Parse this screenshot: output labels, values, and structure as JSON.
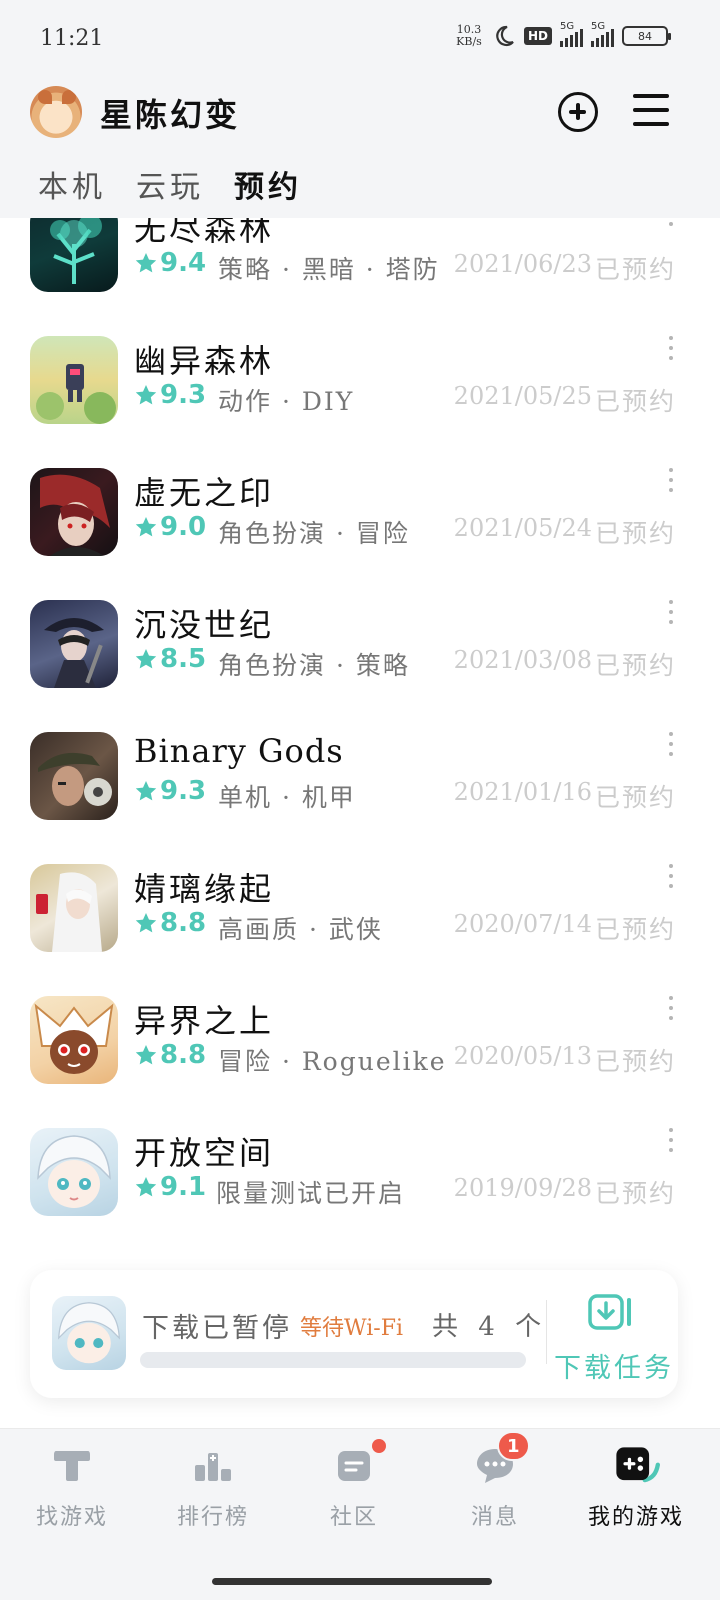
{
  "status_bar": {
    "time": "11:21",
    "net_speed_value": "10.3",
    "net_speed_unit": "KB/s",
    "hd_label": "HD",
    "signal1_label": "5G",
    "signal2_label": "5G",
    "battery": "84"
  },
  "header": {
    "title": "星陈幻变",
    "tabs": [
      {
        "label": "本机",
        "active": false
      },
      {
        "label": "云玩",
        "active": false
      },
      {
        "label": "预约",
        "active": true
      }
    ]
  },
  "games": [
    {
      "name": "无尽森林",
      "rating": "9.4",
      "tags": "策略 · 黑暗 · 塔防",
      "date": "2021/06/23",
      "status": "已预约"
    },
    {
      "name": "幽异森林",
      "rating": "9.3",
      "tags": "动作 · DIY",
      "date": "2021/05/25",
      "status": "已预约"
    },
    {
      "name": "虚无之印",
      "rating": "9.0",
      "tags": "角色扮演 · 冒险",
      "date": "2021/05/24",
      "status": "已预约"
    },
    {
      "name": "沉没世纪",
      "rating": "8.5",
      "tags": "角色扮演 · 策略",
      "date": "2021/03/08",
      "status": "已预约"
    },
    {
      "name": "Binary Gods",
      "rating": "9.3",
      "tags": "单机 · 机甲",
      "date": "2021/01/16",
      "status": "已预约"
    },
    {
      "name": "婧璃缘起",
      "rating": "8.8",
      "tags": "高画质 · 武侠",
      "date": "2020/07/14",
      "status": "已预约"
    },
    {
      "name": "异界之上",
      "rating": "8.8",
      "tags": "冒险 · Roguelike",
      "date": "2020/05/13",
      "status": "已预约"
    },
    {
      "name": "开放空间",
      "rating": "9.1",
      "tags": "限量测试已开启",
      "date": "2019/09/28",
      "status": "已预约"
    }
  ],
  "download": {
    "status": "下载已暂停",
    "wait": "等待Wi-Fi",
    "count": "共 4 个",
    "task_label": "下载任务",
    "progress": 0
  },
  "bottom_nav": [
    {
      "label": "找游戏",
      "icon": "find-game-icon"
    },
    {
      "label": "排行榜",
      "icon": "ranking-icon"
    },
    {
      "label": "社区",
      "icon": "community-icon",
      "dot": true
    },
    {
      "label": "消息",
      "icon": "message-icon",
      "badge": "1"
    },
    {
      "label": "我的游戏",
      "icon": "gamepad-icon",
      "active": true
    }
  ],
  "colors": {
    "accent": "#4fc7b6",
    "wait": "#e07c3e",
    "badge": "#ee5a4b"
  }
}
